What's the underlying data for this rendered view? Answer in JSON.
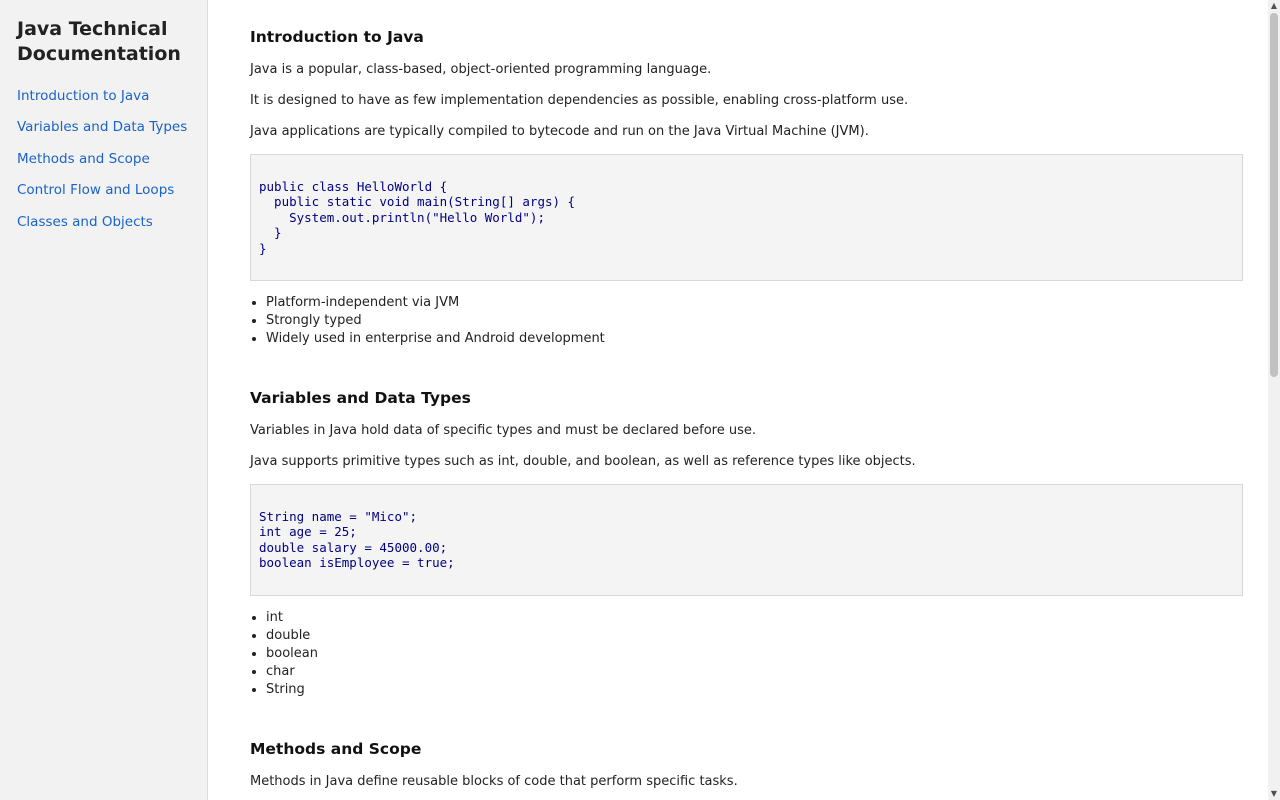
{
  "nav": {
    "title": "Java Technical Documentation",
    "links": [
      "Introduction to Java",
      "Variables and Data Types",
      "Methods and Scope",
      "Control Flow and Loops",
      "Classes and Objects"
    ]
  },
  "sections": [
    {
      "title": "Introduction to Java",
      "paragraphs": [
        "Java is a popular, class-based, object-oriented programming language.",
        "It is designed to have as few implementation dependencies as possible, enabling cross-platform use.",
        "Java applications are typically compiled to bytecode and run on the Java Virtual Machine (JVM)."
      ],
      "code": "public class HelloWorld {\n  public static void main(String[] args) {\n    System.out.println(\"Hello World\");\n  }\n}",
      "list": [
        "Platform-independent via JVM",
        "Strongly typed",
        "Widely used in enterprise and Android development"
      ]
    },
    {
      "title": "Variables and Data Types",
      "paragraphs": [
        "Variables in Java hold data of specific types and must be declared before use.",
        "Java supports primitive types such as int, double, and boolean, as well as reference types like objects."
      ],
      "code": "String name = \"Mico\";\nint age = 25;\ndouble salary = 45000.00;\nboolean isEmployee = true;",
      "list": [
        "int",
        "double",
        "boolean",
        "char",
        "String"
      ]
    },
    {
      "title": "Methods and Scope",
      "paragraphs": [
        "Methods in Java define reusable blocks of code that perform specific tasks."
      ],
      "code": "",
      "list": []
    }
  ],
  "scrollbar": {
    "up_arrow": "▲",
    "down_arrow": "▼"
  }
}
